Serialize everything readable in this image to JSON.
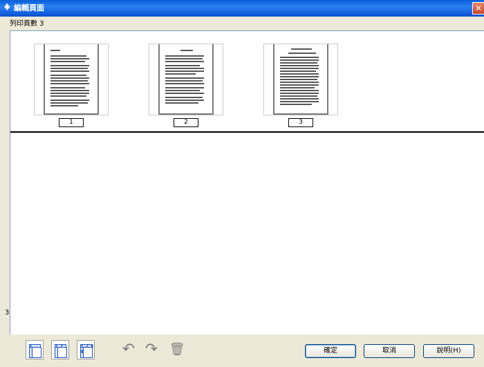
{
  "window": {
    "title": "編輯頁面",
    "icon": "printer-icon"
  },
  "status": {
    "page_count_label": "列印頁數 3"
  },
  "pages": [
    {
      "number": "1"
    },
    {
      "number": "2"
    },
    {
      "number": "3"
    }
  ],
  "toolbar": {
    "layout_buttons": [
      {
        "icon": "single-page-layout-icon",
        "label": "1"
      },
      {
        "icon": "four-page-layout-icon",
        "label": "1 2"
      },
      {
        "icon": "multi-page-layout-icon",
        "label": "1 2 3 4"
      }
    ],
    "rotate_left_icon": "rotate-left-icon",
    "rotate_right_icon": "rotate-right-icon",
    "delete_icon": "trash-icon"
  },
  "buttons": {
    "ok": "確定",
    "cancel": "取消",
    "help": "說明(H)"
  },
  "colors": {
    "titlebar": "#0a5fd8",
    "close": "#c8462a",
    "dialog_bg": "#ece9d8"
  }
}
